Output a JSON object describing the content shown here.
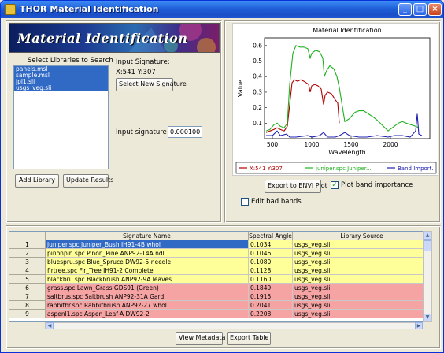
{
  "window": {
    "title": "THOR Material Identification",
    "min_glyph": "_",
    "max_glyph": "□",
    "close_glyph": "×"
  },
  "banner": {
    "title": "Material Identification"
  },
  "libraries": {
    "label": "Select Libraries to Search",
    "items": [
      "panels.msl",
      "sample.msl",
      "jpl1.sli",
      "usgs_veg.sli"
    ],
    "add_button": "Add Library",
    "update_button": "Update Results"
  },
  "signature": {
    "label": "Input Signature:",
    "coords": "X:541 Y:307",
    "select_button": "Select New Signature",
    "scale_label": "Input signature scale:",
    "scale_value": "0.000100"
  },
  "plot_controls": {
    "export_button": "Export to ENVI Plot",
    "plot_band_importance_label": "Plot band importance",
    "plot_band_importance_checked": true,
    "edit_bad_bands_label": "Edit bad bands",
    "edit_bad_bands_checked": false
  },
  "chart_data": {
    "type": "line",
    "title": "Material Identification",
    "xlabel": "Wavelength",
    "ylabel": "Value",
    "xlim": [
      400,
      2500
    ],
    "ylim": [
      0,
      0.65
    ],
    "xticks": [
      500,
      1000,
      1500,
      2000
    ],
    "yticks": [
      0.1,
      0.2,
      0.3,
      0.4,
      0.5,
      0.6
    ],
    "legend": "bottom",
    "series": [
      {
        "name": "X:541 Y:307",
        "color": "#b00000",
        "points": [
          [
            420,
            0.04
          ],
          [
            470,
            0.05
          ],
          [
            520,
            0.06
          ],
          [
            560,
            0.07
          ],
          [
            600,
            0.06
          ],
          [
            650,
            0.05
          ],
          [
            690,
            0.08
          ],
          [
            720,
            0.22
          ],
          [
            750,
            0.36
          ],
          [
            780,
            0.38
          ],
          [
            820,
            0.37
          ],
          [
            860,
            0.38
          ],
          [
            900,
            0.37
          ],
          [
            930,
            0.36
          ],
          [
            960,
            0.35
          ],
          [
            980,
            0.3
          ],
          [
            1000,
            0.34
          ],
          [
            1040,
            0.35
          ],
          [
            1080,
            0.34
          ],
          [
            1120,
            0.32
          ],
          [
            1150,
            0.22
          ],
          [
            1170,
            0.28
          ],
          [
            1200,
            0.3
          ],
          [
            1250,
            0.29
          ],
          [
            1300,
            0.25
          ],
          [
            1330,
            0.23
          ],
          [
            1350,
            0.1
          ]
        ]
      },
      {
        "name": "juniper.spc Juniper...",
        "color": "#20b020",
        "points": [
          [
            420,
            0.05
          ],
          [
            470,
            0.06
          ],
          [
            520,
            0.09
          ],
          [
            560,
            0.1
          ],
          [
            600,
            0.08
          ],
          [
            650,
            0.07
          ],
          [
            690,
            0.1
          ],
          [
            720,
            0.35
          ],
          [
            760,
            0.55
          ],
          [
            800,
            0.6
          ],
          [
            850,
            0.59
          ],
          [
            900,
            0.59
          ],
          [
            950,
            0.58
          ],
          [
            980,
            0.52
          ],
          [
            1000,
            0.55
          ],
          [
            1050,
            0.57
          ],
          [
            1100,
            0.56
          ],
          [
            1140,
            0.52
          ],
          [
            1160,
            0.4
          ],
          [
            1190,
            0.44
          ],
          [
            1230,
            0.47
          ],
          [
            1280,
            0.45
          ],
          [
            1320,
            0.4
          ],
          [
            1350,
            0.33
          ],
          [
            1420,
            0.11
          ],
          [
            1480,
            0.13
          ],
          [
            1550,
            0.17
          ],
          [
            1600,
            0.18
          ],
          [
            1660,
            0.18
          ],
          [
            1720,
            0.16
          ],
          [
            1780,
            0.14
          ],
          [
            1830,
            0.12
          ],
          [
            1970,
            0.05
          ],
          [
            2050,
            0.08
          ],
          [
            2100,
            0.1
          ],
          [
            2150,
            0.11
          ],
          [
            2200,
            0.1
          ],
          [
            2260,
            0.09
          ],
          [
            2320,
            0.08
          ],
          [
            2360,
            0.07
          ]
        ]
      },
      {
        "name": "Band Import.",
        "color": "#2020b0",
        "points": [
          [
            420,
            0.02
          ],
          [
            500,
            0.02
          ],
          [
            560,
            0.05
          ],
          [
            600,
            0.02
          ],
          [
            680,
            0.03
          ],
          [
            720,
            0.01
          ],
          [
            800,
            0.01
          ],
          [
            950,
            0.02
          ],
          [
            1000,
            0.01
          ],
          [
            1100,
            0.02
          ],
          [
            1150,
            0.04
          ],
          [
            1200,
            0.01
          ],
          [
            1300,
            0.01
          ],
          [
            1350,
            0.02
          ],
          [
            1420,
            0.04
          ],
          [
            1480,
            0.02
          ],
          [
            1600,
            0.01
          ],
          [
            1700,
            0.01
          ],
          [
            1830,
            0.02
          ],
          [
            1970,
            0.01
          ],
          [
            2050,
            0.02
          ],
          [
            2150,
            0.02
          ],
          [
            2250,
            0.01
          ],
          [
            2320,
            0.05
          ],
          [
            2340,
            0.16
          ],
          [
            2360,
            0.03
          ],
          [
            2400,
            0.02
          ]
        ]
      }
    ]
  },
  "results": {
    "columns": [
      "Signature Name",
      "Spectral Angle",
      "Library Source"
    ],
    "rows": [
      {
        "num": "1",
        "name": "juniper.spc Juniper_Bush IH91-4B whol",
        "angle": "0.1034",
        "source": "usgs_veg.sli",
        "color": "#ffff99",
        "selected": true
      },
      {
        "num": "2",
        "name": "pinonpin.spc Pinon_Pine ANP92-14A ndl",
        "angle": "0.1046",
        "source": "usgs_veg.sli",
        "color": "#ffff99",
        "selected": false
      },
      {
        "num": "3",
        "name": "bluespru.spc Blue_Spruce DW92-5 needle",
        "angle": "0.1080",
        "source": "usgs_veg.sli",
        "color": "#ffff99",
        "selected": false
      },
      {
        "num": "4",
        "name": "firtree.spc Fir_Tree IH91-2 Complete",
        "angle": "0.1128",
        "source": "usgs_veg.sli",
        "color": "#ffff99",
        "selected": false
      },
      {
        "num": "5",
        "name": "blackbru.spc Blackbrush ANP92-9A leaves",
        "angle": "0.1160",
        "source": "usgs_veg.sli",
        "color": "#ffff99",
        "selected": false
      },
      {
        "num": "6",
        "name": "grass.spc Lawn_Grass GDS91 (Green)",
        "angle": "0.1849",
        "source": "usgs_veg.sli",
        "color": "#f5a3a3",
        "selected": false
      },
      {
        "num": "7",
        "name": "saltbrus.spc Saltbrush ANP92-31A Gard",
        "angle": "0.1915",
        "source": "usgs_veg.sli",
        "color": "#f5a3a3",
        "selected": false
      },
      {
        "num": "8",
        "name": "rabbitbr.spc Rabbitbrush ANP92-27 whol",
        "angle": "0.2041",
        "source": "usgs_veg.sli",
        "color": "#f5a3a3",
        "selected": false
      },
      {
        "num": "9",
        "name": "aspenl1.spc Aspen_Leaf-A DW92-2",
        "angle": "0.2208",
        "source": "usgs_veg.sli",
        "color": "#f5a3a3",
        "selected": false
      }
    ],
    "view_metadata_button": "View Metadata",
    "export_table_button": "Export Table"
  }
}
